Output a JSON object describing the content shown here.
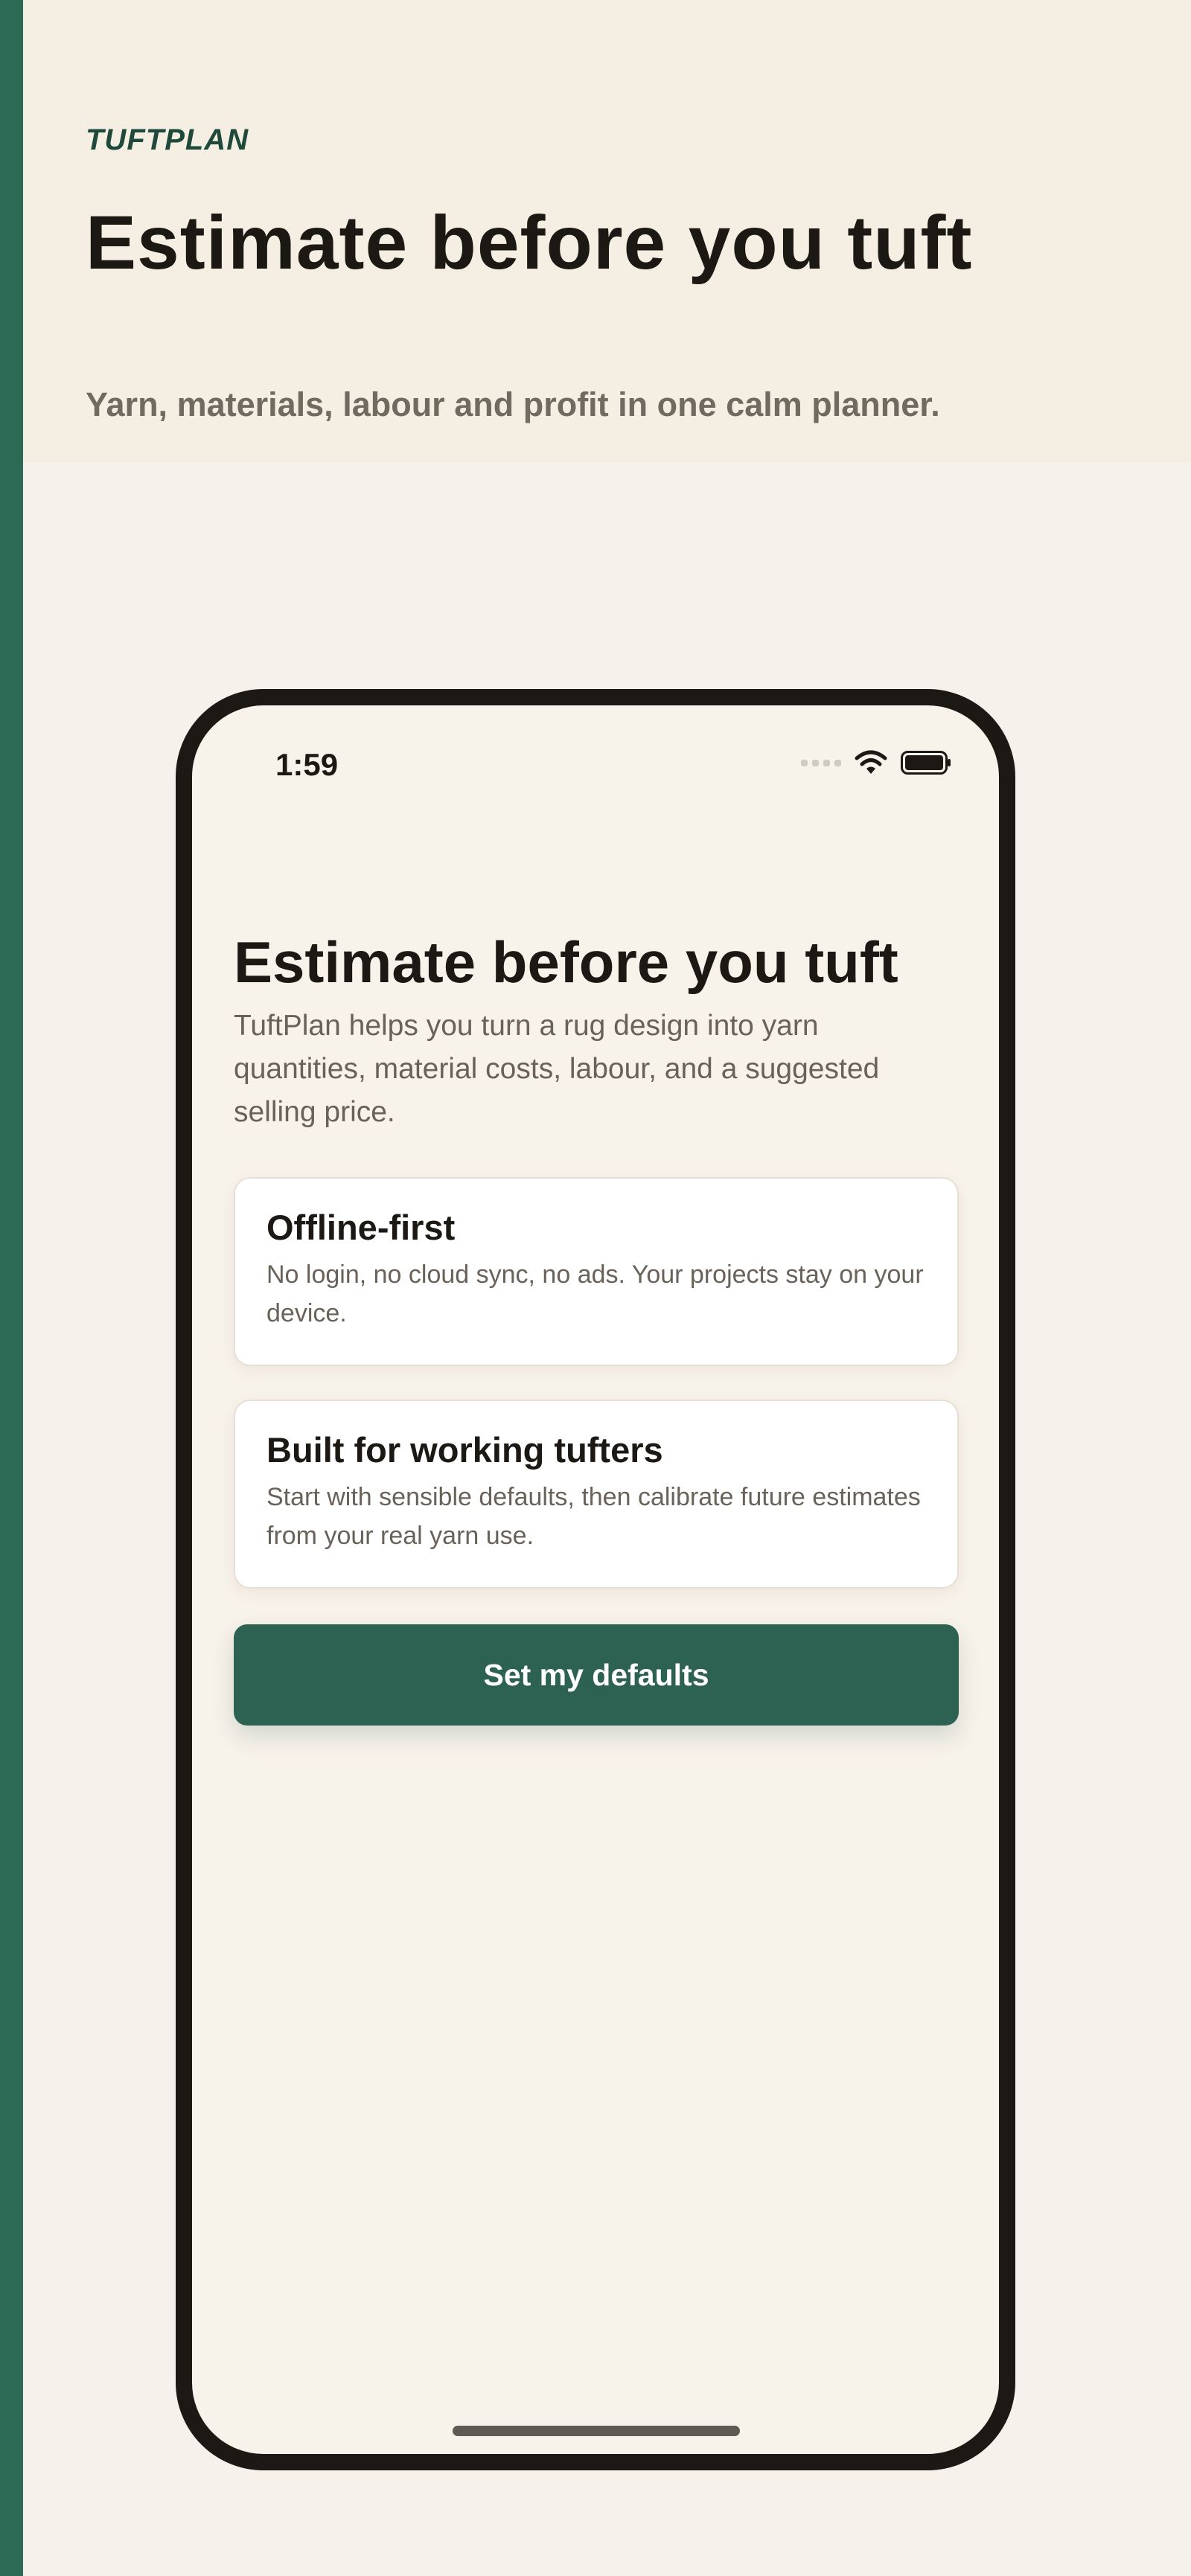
{
  "header": {
    "brand": "TUFTPLAN",
    "title": "Estimate before you tuft",
    "subtitle": "Yarn, materials, labour and profit in one calm planner."
  },
  "status_bar": {
    "time": "1:59",
    "icons": [
      "cellular-signal-icon",
      "wifi-icon",
      "battery-icon"
    ]
  },
  "screen": {
    "title": "Estimate before you tuft",
    "intro": "TuftPlan helps you turn a rug design into yarn quantities, material costs, labour, and a suggested selling price.",
    "cards": [
      {
        "title": "Offline-first",
        "text": "No login, no cloud sync, no ads. Your projects stay on your device."
      },
      {
        "title": "Built for working tufters",
        "text": "Start with sensible defaults, then calibrate future estimates from your real yarn use."
      }
    ],
    "primary_button": "Set my defaults"
  },
  "colors": {
    "accent": "#2d6a55",
    "button": "#2d6151",
    "header_background": "#f5efe3",
    "page_background": "#f6f1ea",
    "text_dark": "#1c1914",
    "text_muted": "#6a6258"
  }
}
